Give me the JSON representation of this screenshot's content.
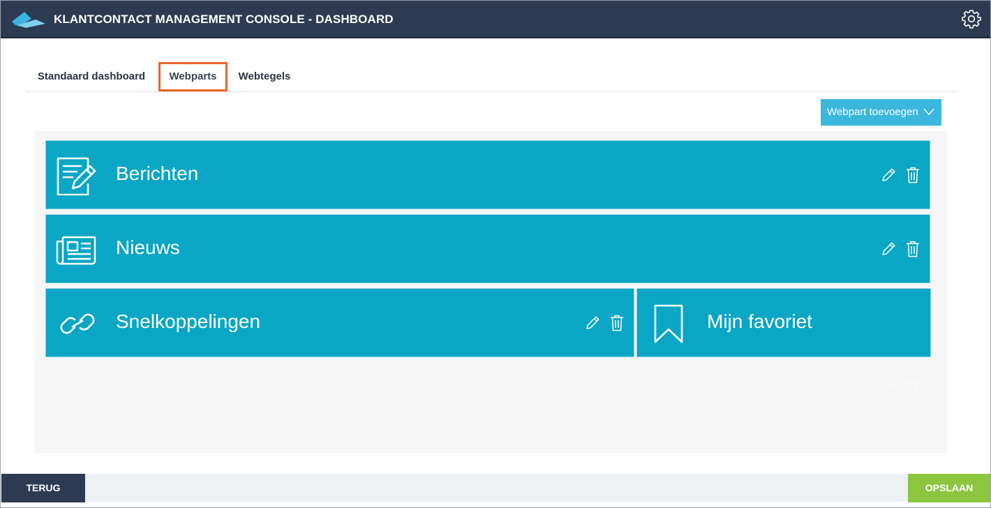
{
  "header": {
    "title": "KLANTCONTACT MANAGEMENT CONSOLE - DASHBOARD",
    "logo_icon": "logo-icon",
    "settings_icon": "gear-icon"
  },
  "tabs": [
    {
      "label": "Standaard dashboard",
      "active": false
    },
    {
      "label": "Webparts",
      "active": true
    },
    {
      "label": "Webtegels",
      "active": false
    }
  ],
  "toolbar": {
    "add_label": "Webpart toevoegen",
    "add_icon": "chevron-down-icon"
  },
  "webparts": [
    {
      "label": "Berichten",
      "icon": "message-edit-icon"
    },
    {
      "label": "Nieuws",
      "icon": "newspaper-icon"
    },
    {
      "label": "Snelkoppelingen",
      "icon": "link-icon"
    },
    {
      "label": "Mijn favoriet",
      "icon": "bookmark-icon"
    }
  ],
  "footer": {
    "back_label": "TERUG",
    "save_label": "OPSLAAN"
  },
  "colors": {
    "header_bg": "#2d3b52",
    "tile_bg": "#0aa6c5",
    "add_button": "#3bb7de",
    "active_tab_outline": "#e8652b",
    "save_button": "#8cc63f"
  }
}
